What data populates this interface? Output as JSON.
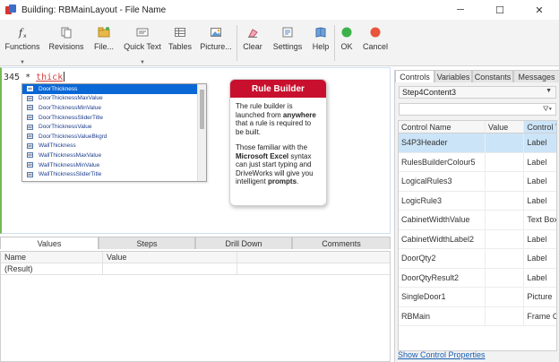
{
  "window": {
    "title": "Building: RBMainLayout - File Name",
    "min": "─",
    "max": "☐",
    "close": "✕"
  },
  "ribbon": {
    "functions": "Functions",
    "revisions": "Revisions",
    "file": "File...",
    "quick_text": "Quick Text",
    "tables": "Tables",
    "picture": "Picture...",
    "clear": "Clear",
    "settings": "Settings",
    "help": "Help",
    "ok": "OK",
    "cancel": "Cancel"
  },
  "editor": {
    "prefix": "345 * ",
    "typed": "thick",
    "autocomplete": [
      "DoorThickness",
      "DoorThicknessMaxValue",
      "DoorThicknessMinValue",
      "DoorThicknessSliderTitle",
      "DoorThicknessValue",
      "DoorThicknessValueBkgrd",
      "WallThickness",
      "WallThicknessMaxValue",
      "WallThicknessMinValue",
      "WallThicknessSliderTitle"
    ]
  },
  "rule_builder": {
    "title": "Rule Builder",
    "p1_a": "The rule builder is launched from ",
    "p1_b": "anywhere",
    "p1_c": " that a rule is required to be built.",
    "p2_a": "Those familiar with the ",
    "p2_b": "Microsoft Excel",
    "p2_c": " syntax can just start typing and DriveWorks will give you intelligent ",
    "p2_d": "prompts",
    "p2_e": "."
  },
  "bottom_tabs": [
    "Values",
    "Steps",
    "Drill Down",
    "Comments"
  ],
  "values_grid": {
    "headers": [
      "Name",
      "Value"
    ],
    "rows": [
      [
        "(Result)",
        ""
      ]
    ]
  },
  "right_tabs": [
    "Controls",
    "Variables",
    "Constants",
    "Messages"
  ],
  "controls": {
    "selected_form": "Step4Content3",
    "headers": [
      "Control Name",
      "Value",
      "Control Type"
    ],
    "rows": [
      [
        "S4P3Header",
        "",
        "Label"
      ],
      [
        "RulesBuilderColour5",
        "",
        "Label"
      ],
      [
        "LogicalRules3",
        "",
        "Label"
      ],
      [
        "LogicRule3",
        "",
        "Label"
      ],
      [
        "CabinetWidthValue",
        "",
        "Text Box"
      ],
      [
        "CabinetWidthLabel2",
        "",
        "Label"
      ],
      [
        "DoorQty2",
        "",
        "Label"
      ],
      [
        "DoorQtyResult2",
        "",
        "Label"
      ],
      [
        "SingleDoor1",
        "",
        "Picture"
      ],
      [
        "RBMain",
        "",
        "Frame Control"
      ]
    ],
    "show_properties": "Show Control Properties"
  }
}
